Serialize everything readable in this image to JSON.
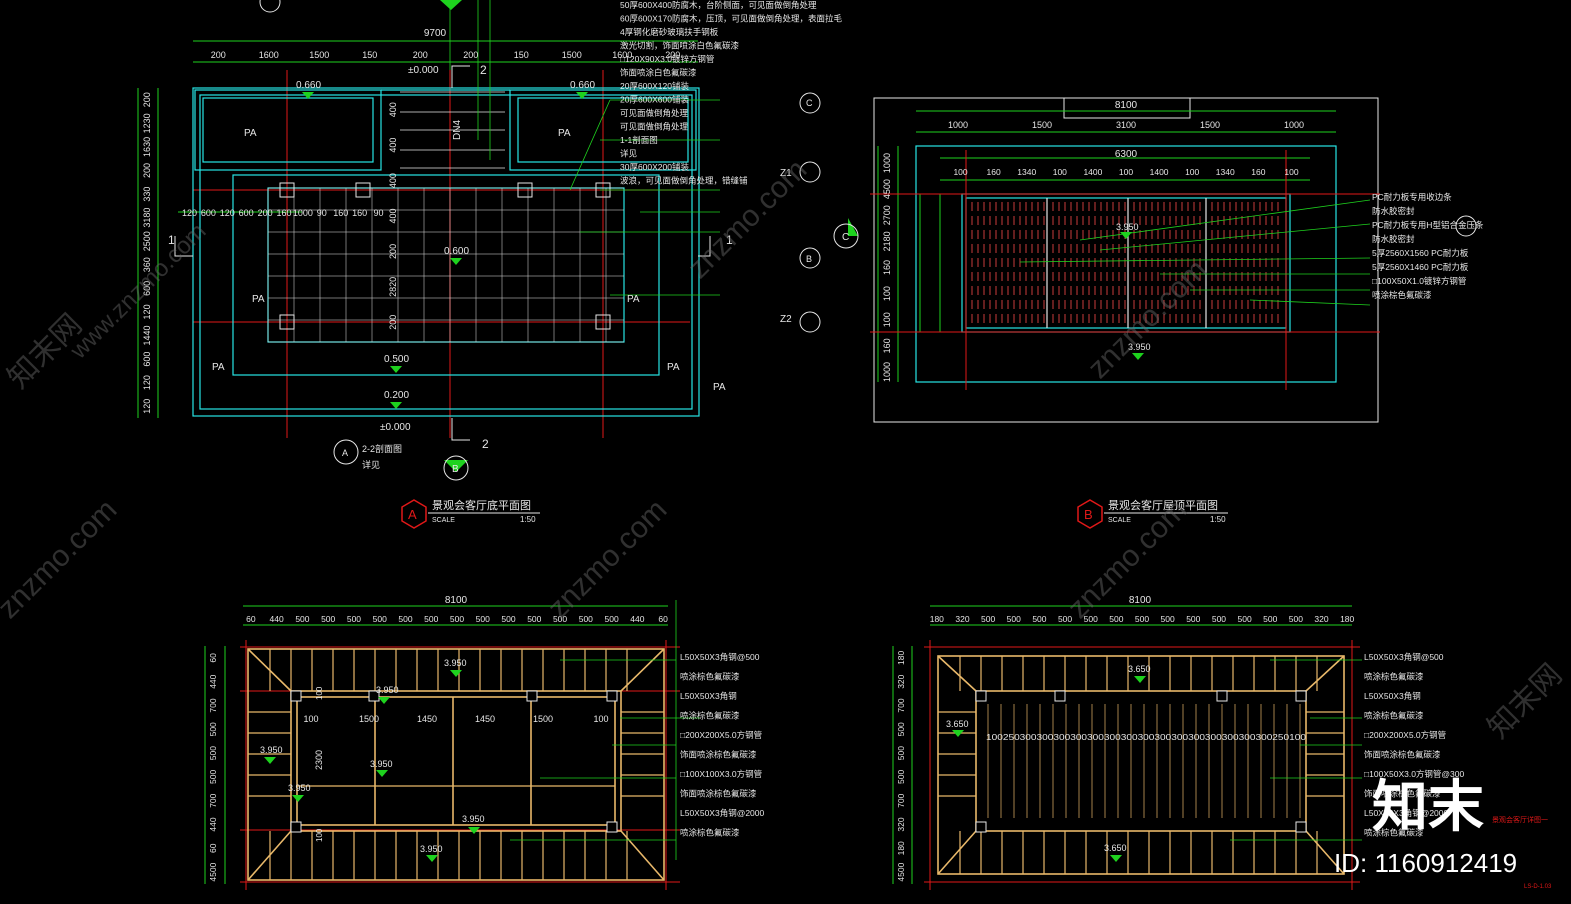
{
  "colors": {
    "background": "#000000",
    "cyan": "#27e4e4",
    "white": "#e6e6e6",
    "green": "#1ed21e",
    "red": "#e01818",
    "yellow": "#e0d400",
    "orange": "#e8b86a",
    "magenta": "#e040e0",
    "wood": "#b06040"
  },
  "plan_a": {
    "title": "景观会客厅底平面图",
    "label": "A",
    "scale_word": "SCALE",
    "scale": "1:50",
    "total_width": "9700",
    "top_dims": [
      "200",
      "1600",
      "1500",
      "150",
      "200",
      "200",
      "150",
      "1500",
      "1600",
      "200"
    ],
    "left_dims": [
      "200",
      "1230",
      "1630",
      "200",
      "330",
      "3180",
      "2500",
      "360",
      "600",
      "120",
      "1440",
      "600",
      "120",
      "120"
    ],
    "inner_dims": [
      "120",
      "600",
      "120",
      "600",
      "200",
      "160",
      "1000",
      "90",
      "160",
      "160",
      "90"
    ],
    "vert_dims": [
      "400",
      "400",
      "400",
      "400",
      "200",
      "2820",
      "200"
    ],
    "levels": [
      "0.660",
      "0.660",
      "±0.000",
      "0.600",
      "0.500",
      "0.200",
      "±0.000"
    ],
    "pa": [
      "PA",
      "PA",
      "PA",
      "PA",
      "PA",
      "PA",
      "PA"
    ],
    "dn": "DN4",
    "section_marks": [
      "1",
      "1",
      "2",
      "2"
    ],
    "callouts": [
      "50厚600X400防腐木，台阶侧面，可见面做倒角处理",
      "60厚600X170防腐木，压顶，可见面做倒角处理，表面拉毛",
      "4厚钢化磨砂玻璃扶手钢板",
      "激光切割，饰面喷涂白色氟碳漆",
      "□120X90X3.0镀锌方钢管",
      "饰面喷涂白色氟碳漆",
      "20厚600X120铺装",
      "20厚600X600铺装",
      "可见面做倒角处理",
      "可见面做倒角处理",
      "1-1剖面图",
      "详见",
      "30厚600X200铺装",
      "波浪，可见面做倒角处理，错缝铺"
    ],
    "z_labels": [
      "Z1",
      "Z2"
    ],
    "section_note": "2-2剖面图",
    "section_note2": "详见",
    "detail_tags": [
      "C",
      "B",
      "A",
      "B",
      "C"
    ]
  },
  "plan_b": {
    "title": "景观会客厅屋顶平面图",
    "label": "B",
    "scale_word": "SCALE",
    "scale": "1:50",
    "total_width": "8100",
    "top_dims": [
      "1000",
      "1500",
      "3100",
      "1500",
      "1000"
    ],
    "mid_width": "6300",
    "inner_dims": [
      "100",
      "160",
      "1340",
      "100",
      "1400",
      "100",
      "1400",
      "100",
      "1340",
      "160",
      "100"
    ],
    "left_dims": [
      "1000",
      "4500",
      "2700",
      "2180",
      "160",
      "100",
      "100",
      "160",
      "1000"
    ],
    "levels": [
      "3.950",
      "3.950"
    ],
    "callouts": [
      "PC耐力板专用收边条",
      "防水胶密封",
      "PC耐力板专用H型铝合金压条",
      "防水胶密封",
      "5厚2560X1560 PC耐力板",
      "5厚2560X1460 PC耐力板",
      "□100X50X1.0镀锌方钢管",
      "喷涂棕色氟碳漆"
    ]
  },
  "plan_c": {
    "total_width": "8100",
    "top_dims": [
      "60",
      "440",
      "500",
      "500",
      "500",
      "500",
      "500",
      "500",
      "500",
      "500",
      "500",
      "500",
      "500",
      "500",
      "500",
      "440",
      "60"
    ],
    "left_dims": [
      "60",
      "440",
      "700",
      "500",
      "500",
      "500",
      "700",
      "440",
      "60",
      "4500"
    ],
    "mid_dims": [
      "100",
      "1500",
      "1450",
      "1450",
      "1500",
      "100"
    ],
    "vert": [
      "2300",
      "100",
      "100"
    ],
    "levels": [
      "3.950",
      "3.950",
      "3.950",
      "3.950",
      "3.950",
      "3.950",
      "3.950"
    ],
    "callouts": [
      "L50X50X3角钢@500",
      "喷涂棕色氟碳漆",
      "L50X50X3角钢",
      "喷涂棕色氟碳漆",
      "□200X200X5.0方钢管",
      "饰面喷涂棕色氟碳漆",
      "□100X100X3.0方钢管",
      "饰面喷涂棕色氟碳漆",
      "L50X50X3角钢@2000",
      "喷涂棕色氟碳漆"
    ]
  },
  "plan_d": {
    "total_width": "8100",
    "top_dims": [
      "180",
      "320",
      "500",
      "500",
      "500",
      "500",
      "500",
      "500",
      "500",
      "500",
      "500",
      "500",
      "500",
      "500",
      "500",
      "320",
      "180"
    ],
    "left_dims": [
      "180",
      "320",
      "700",
      "500",
      "500",
      "500",
      "700",
      "320",
      "180",
      "4500"
    ],
    "rafter_dims": "100250300300300300300300300300300300300300300300300250100",
    "levels": [
      "3.650",
      "3.650",
      "3.650"
    ],
    "callouts": [
      "L50X50X3角钢@500",
      "喷涂棕色氟碳漆",
      "L50X50X3角钢",
      "喷涂棕色氟碳漆",
      "□200X200X5.0方钢管",
      "饰面喷涂棕色氟碳漆",
      "□100X50X3.0方钢管@300",
      "饰面喷涂棕色氟碳漆",
      "L50X50X3角钢@2000",
      "喷涂棕色氟碳漆"
    ]
  },
  "watermark": {
    "site": "www.znzmo.com",
    "site_short": "znzmo.com",
    "brand": "知末网",
    "logo": "知末",
    "id": "ID: 1160912419",
    "sheet": "LS-D-1.03",
    "tag": "景观会客厅详图一"
  }
}
